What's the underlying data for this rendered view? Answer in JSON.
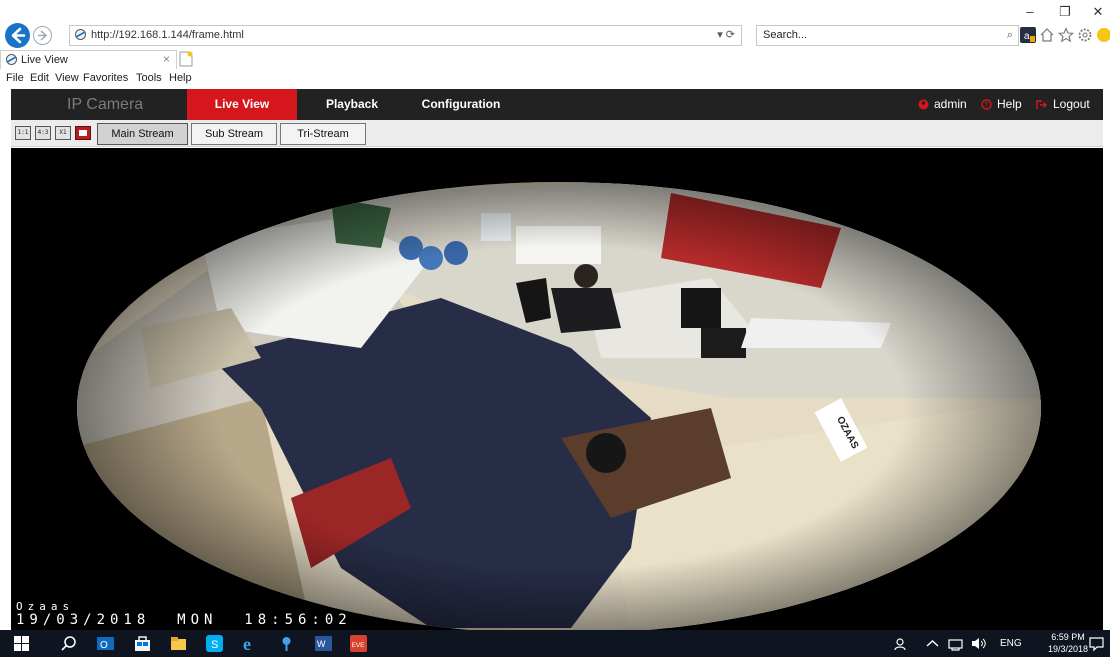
{
  "browser": {
    "window_controls": {
      "minimize": "–",
      "restore": "❐",
      "close": "✕"
    },
    "address_url": "http://192.168.1.144/frame.html",
    "address_tools": "▾ ⟳",
    "search_placeholder": "Search...",
    "search_icon": "⌕",
    "tab_title": "Live View",
    "tab_close": "×",
    "menu": [
      "File",
      "Edit",
      "View",
      "Favorites",
      "Tools",
      "Help"
    ],
    "toolbar_icons": [
      "home-icon",
      "favorites-star-icon",
      "settings-gear-icon",
      "smiley-feedback-icon"
    ]
  },
  "app": {
    "brand": "IP Camera",
    "nav": [
      {
        "label": "Live View",
        "active": true
      },
      {
        "label": "Playback",
        "active": false
      },
      {
        "label": "Configuration",
        "active": false
      }
    ],
    "user": "admin",
    "help": "Help",
    "logout": "Logout",
    "accent_color": "#d6161d"
  },
  "toolbar": {
    "layout_buttons": [
      "1:1",
      "4:3",
      "X1",
      "REC"
    ],
    "streams": [
      {
        "label": "Main Stream",
        "active": true
      },
      {
        "label": "Sub Stream",
        "active": false
      },
      {
        "label": "Tri-Stream",
        "active": false
      }
    ]
  },
  "video": {
    "osd_name": "Ozaas",
    "osd_datetime": "19/03/2018  MON  18:56:02",
    "sign_text": "OZAAS"
  },
  "taskbar": {
    "apps": [
      "windows-start-icon",
      "search-icon",
      "outlook-icon",
      "store-icon",
      "file-explorer-icon",
      "skype-icon",
      "internet-explorer-icon",
      "pin-app-icon",
      "word-icon",
      "eve-app-icon"
    ],
    "tray_lang": "ENG",
    "time": "6:59 PM",
    "date": "19/3/2018"
  }
}
